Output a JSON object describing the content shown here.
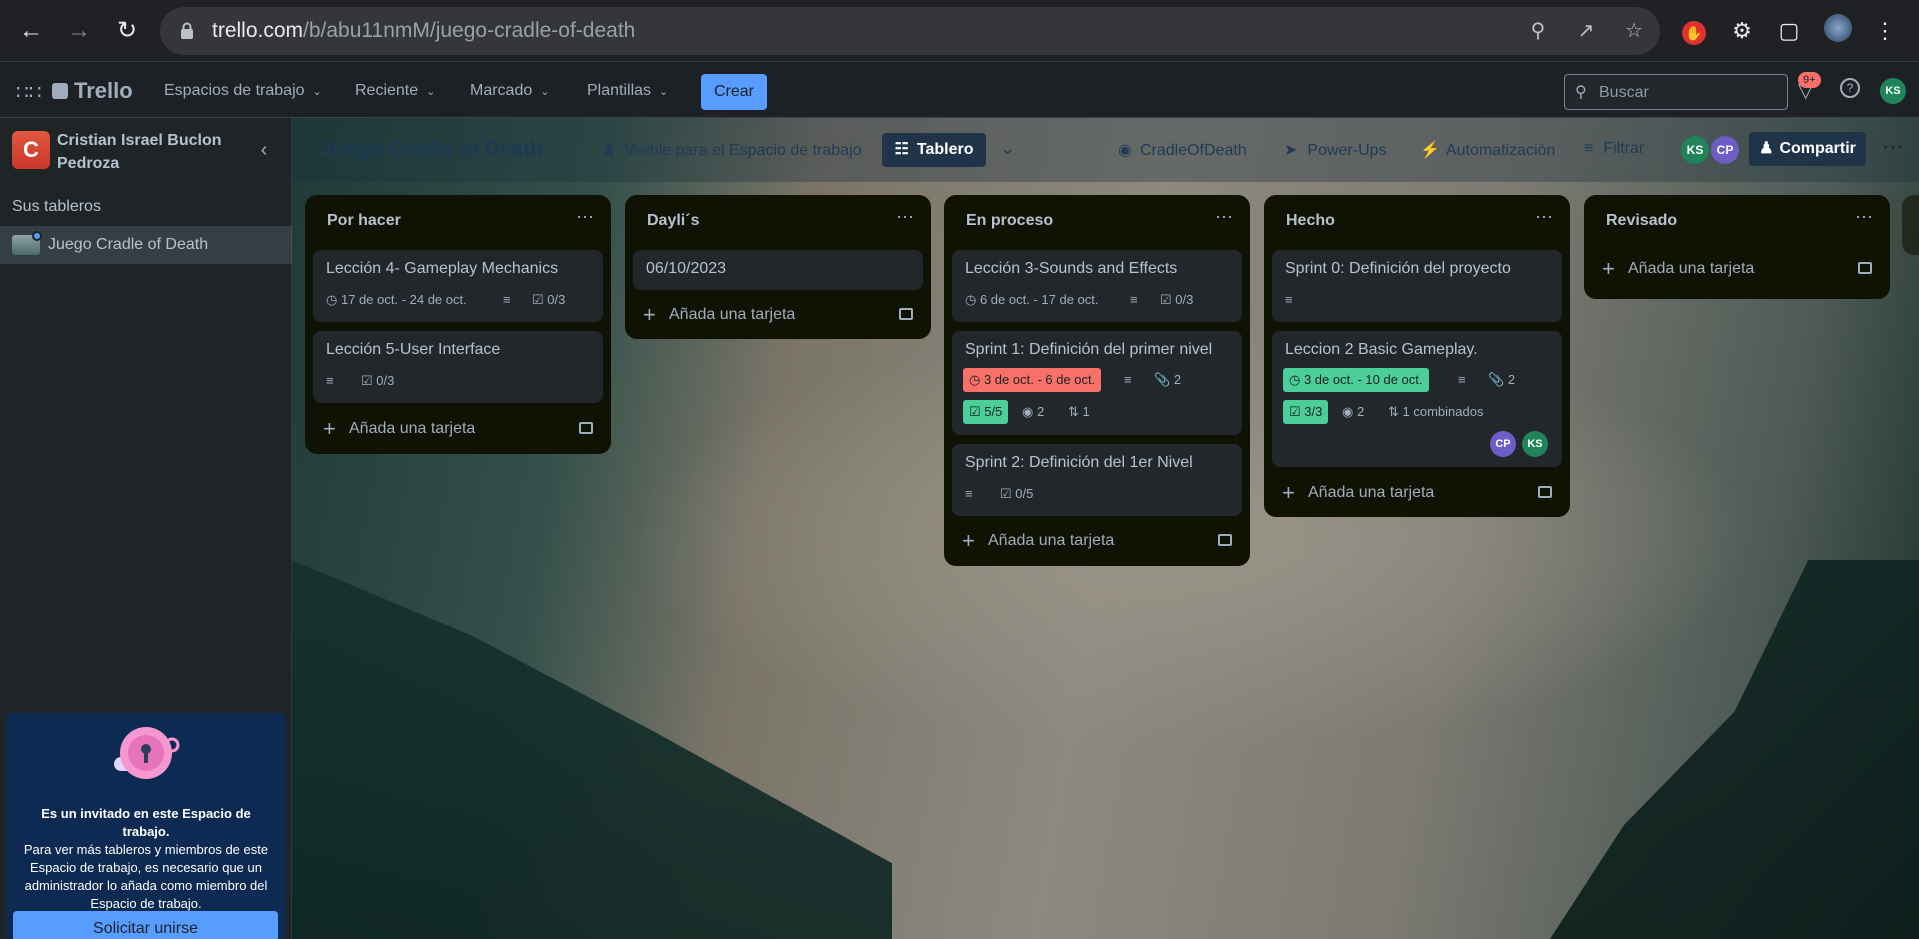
{
  "browser": {
    "url_host": "trello.com",
    "url_path": "/b/abu11nmM/juego-cradle-of-death",
    "ext_badge": "9+"
  },
  "appbar": {
    "logo": "Trello",
    "menus": [
      "Espacios de trabajo",
      "Reciente",
      "Marcado",
      "Plantillas"
    ],
    "create_label": "Crear",
    "search_placeholder": "Buscar",
    "user_initials": "KS"
  },
  "sidebar": {
    "workspace_initial": "C",
    "workspace_name": "Cristian Israel Buclon Pedroza",
    "boards_heading": "Sus tableros",
    "boards": [
      "Juego Cradle of Death"
    ],
    "invite_title": "Es un invitado en este Espacio de trabajo.",
    "invite_body": "Para ver más tableros y miembros de este Espacio de trabajo, es necesario que un administrador lo añada como miembro del Espacio de trabajo.",
    "invite_button": "Solicitar unirse"
  },
  "board": {
    "title": "Juego Cradle of Death",
    "visibility": "Visible para el Espacio de trabajo",
    "view": "Tablero",
    "github": "CradleOfDeath",
    "powerups": "Power-Ups",
    "automation": "Automatización",
    "filter": "Filtrar",
    "members": [
      "KS",
      "CP"
    ],
    "share": "Compartir",
    "add_card": "Añada una tarjeta"
  },
  "lists": [
    {
      "title": "Por hacer",
      "cards": [
        {
          "title": "Lección 4- Gameplay Mechanics",
          "date": "17 de oct. - 24 de oct.",
          "checklist": "0/3"
        },
        {
          "title": "Lección 5-User Interface",
          "checklist": "0/3"
        }
      ]
    },
    {
      "title": "Dayli´s",
      "cards": [
        {
          "title": "06/10/2023"
        }
      ]
    },
    {
      "title": "En proceso",
      "cards": [
        {
          "title": "Lección 3-Sounds and Effects",
          "date": "6 de oct. - 17 de oct.",
          "checklist": "0/3"
        },
        {
          "title": "Sprint 1: Definición del primer nivel",
          "date": "3 de oct. - 6 de oct.",
          "attachments": "2",
          "checklist": "5/5",
          "github": "2",
          "pr": "1"
        },
        {
          "title": "Sprint 2: Definición del 1er Nivel",
          "checklist": "0/5"
        }
      ]
    },
    {
      "title": "Hecho",
      "cards": [
        {
          "title": "Sprint 0: Definición del proyecto"
        },
        {
          "title": "Leccion 2 Basic Gameplay.",
          "date": "3 de oct. - 10 de oct.",
          "attachments": "2",
          "checklist": "3/3",
          "github": "2",
          "merged": "1 combinados",
          "members": [
            "CP",
            "KS"
          ]
        }
      ]
    },
    {
      "title": "Revisado",
      "cards": []
    }
  ],
  "colors": {
    "accent": "#579dff",
    "overdue": "#f87168",
    "complete": "#4bce97",
    "ks": "#1f845a",
    "cp": "#6e5dc6"
  }
}
